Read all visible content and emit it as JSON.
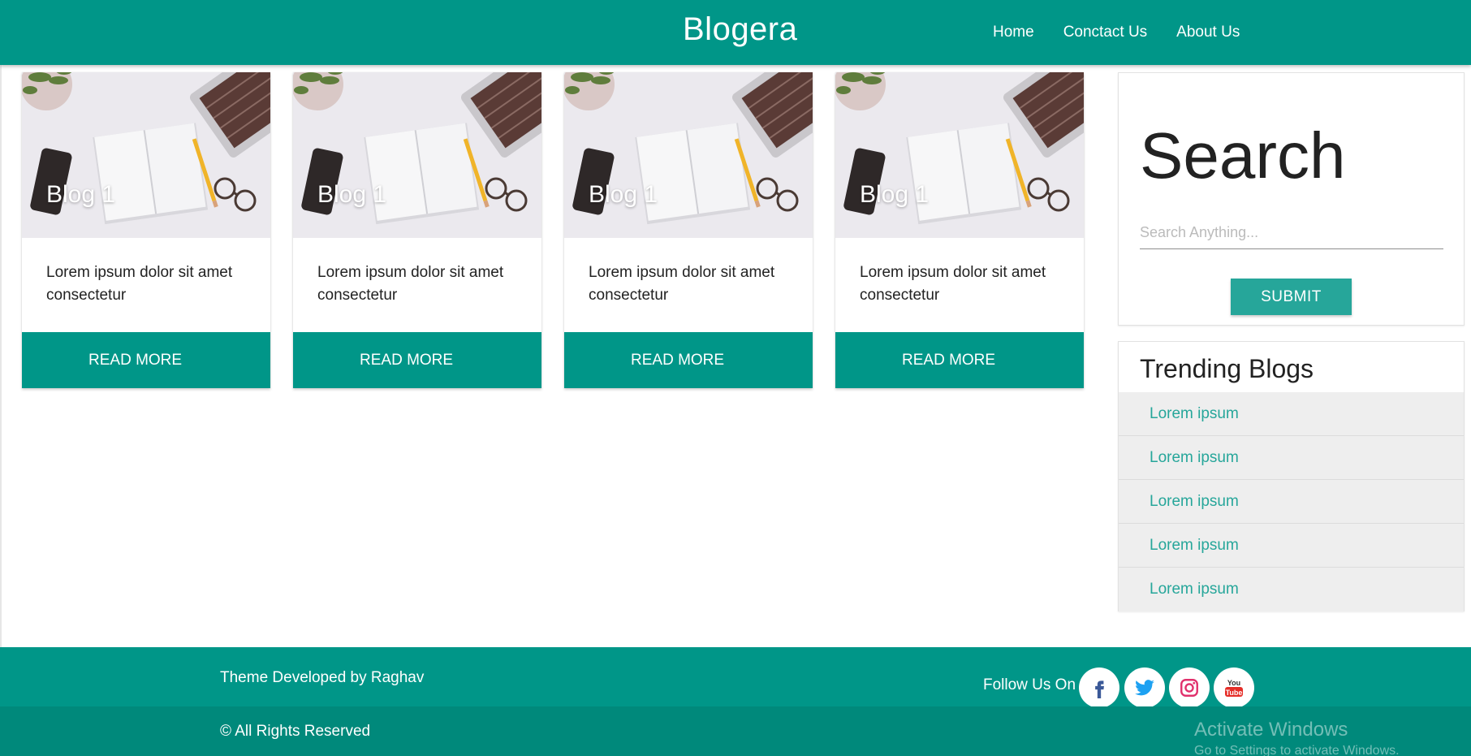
{
  "navbar": {
    "brand": "Blogera",
    "links": [
      "Home",
      "Conctact Us",
      "About Us"
    ]
  },
  "cards": [
    {
      "title": "Blog 1",
      "text": "Lorem ipsum dolor sit amet consectetur",
      "button": "READ MORE"
    },
    {
      "title": "Blog 1",
      "text": "Lorem ipsum dolor sit amet consectetur",
      "button": "READ MORE"
    },
    {
      "title": "Blog 1",
      "text": "Lorem ipsum dolor sit amet consectetur",
      "button": "READ MORE"
    },
    {
      "title": "Blog 1",
      "text": "Lorem ipsum dolor sit amet consectetur",
      "button": "READ MORE"
    }
  ],
  "sidebar": {
    "search": {
      "title": "Search",
      "placeholder": "Search Anything...",
      "value": "",
      "submit_label": "SUBMIT"
    },
    "trending": {
      "title": "Trending Blogs",
      "items": [
        "Lorem ipsum",
        "Lorem ipsum",
        "Lorem ipsum",
        "Lorem ipsum",
        "Lorem ipsum"
      ]
    }
  },
  "footer": {
    "credit": "Theme Developed by Raghav",
    "follow_label": "Follow Us On",
    "social": [
      "facebook-icon",
      "twitter-icon",
      "instagram-icon",
      "youtube-icon"
    ],
    "copyright": "© All Rights Reserved",
    "watermark_title": "Activate Windows",
    "watermark_sub": "Go to Settings to activate Windows."
  },
  "colors": {
    "primary": "#009688",
    "primary_dark": "#00897b",
    "accent": "#26a69a",
    "facebook": "#3b5998",
    "twitter": "#1da1f2",
    "instagram": "#e1306c",
    "youtube": "#e52d27"
  }
}
